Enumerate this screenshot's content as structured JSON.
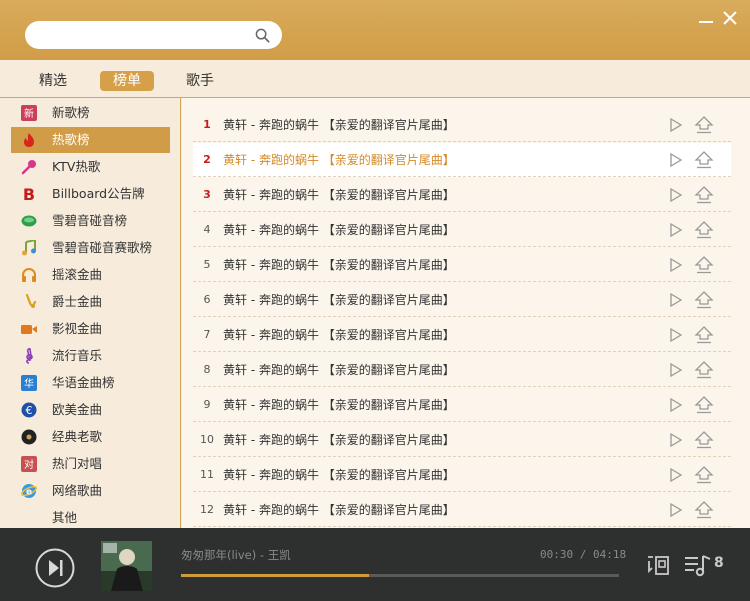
{
  "search": {
    "value": "",
    "placeholder": ""
  },
  "window": {
    "minimize_icon": "minimize-icon",
    "close_icon": "close-icon"
  },
  "tabs": [
    {
      "label": "精选"
    },
    {
      "label": "榜单",
      "active": true
    },
    {
      "label": "歌手"
    }
  ],
  "sidebar": {
    "items": [
      {
        "label": "新歌榜",
        "icon": "new-badge-icon"
      },
      {
        "label": "热歌榜",
        "icon": "flame-icon",
        "active": true
      },
      {
        "label": "KTV热歌",
        "icon": "microphone-icon"
      },
      {
        "label": "Billboard公告牌",
        "icon": "billboard-b-icon"
      },
      {
        "label": "雪碧音碰音榜",
        "icon": "sprite-icon"
      },
      {
        "label": "雪碧音碰音赛歌榜",
        "icon": "music-note-icon"
      },
      {
        "label": "摇滚金曲",
        "icon": "headphones-icon"
      },
      {
        "label": "爵士金曲",
        "icon": "saxophone-icon"
      },
      {
        "label": "影视金曲",
        "icon": "video-camera-icon"
      },
      {
        "label": "流行音乐",
        "icon": "treble-clef-icon"
      },
      {
        "label": "华语金曲榜",
        "icon": "hua-badge-icon"
      },
      {
        "label": "欧美金曲",
        "icon": "euro-icon"
      },
      {
        "label": "经典老歌",
        "icon": "vinyl-record-icon"
      },
      {
        "label": "热门对唱",
        "icon": "duet-icon"
      },
      {
        "label": "网络歌曲",
        "icon": "globe-icon"
      },
      {
        "label": "其他",
        "icon": ""
      }
    ]
  },
  "songs": [
    {
      "rank": "1",
      "title": "黄轩 - 奔跑的蜗牛 【亲爱的翻译官片尾曲】"
    },
    {
      "rank": "2",
      "title": "黄轩 - 奔跑的蜗牛 【亲爱的翻译官片尾曲】"
    },
    {
      "rank": "3",
      "title": "黄轩 - 奔跑的蜗牛 【亲爱的翻译官片尾曲】"
    },
    {
      "rank": "4",
      "title": "黄轩 - 奔跑的蜗牛 【亲爱的翻译官片尾曲】"
    },
    {
      "rank": "5",
      "title": "黄轩 - 奔跑的蜗牛 【亲爱的翻译官片尾曲】"
    },
    {
      "rank": "6",
      "title": "黄轩 - 奔跑的蜗牛 【亲爱的翻译官片尾曲】"
    },
    {
      "rank": "7",
      "title": "黄轩 - 奔跑的蜗牛 【亲爱的翻译官片尾曲】"
    },
    {
      "rank": "8",
      "title": "黄轩 - 奔跑的蜗牛 【亲爱的翻译官片尾曲】"
    },
    {
      "rank": "9",
      "title": "黄轩 - 奔跑的蜗牛 【亲爱的翻译官片尾曲】"
    },
    {
      "rank": "10",
      "title": "黄轩 - 奔跑的蜗牛 【亲爱的翻译官片尾曲】"
    },
    {
      "rank": "11",
      "title": "黄轩 - 奔跑的蜗牛 【亲爱的翻译官片尾曲】"
    },
    {
      "rank": "12",
      "title": "黄轩 - 奔跑的蜗牛 【亲爱的翻译官片尾曲】"
    }
  ],
  "player": {
    "song": "匆匆那年(live) - 王凯",
    "time": "00:30 / 04:18",
    "progress": 0.43,
    "playlist_count": "8",
    "accent_color": "#cf9a3a"
  },
  "colors": {
    "header": "#d19d47",
    "active": "#d09c48",
    "rank_top": "#cc1b1b",
    "highlight_text": "#d38a26"
  }
}
